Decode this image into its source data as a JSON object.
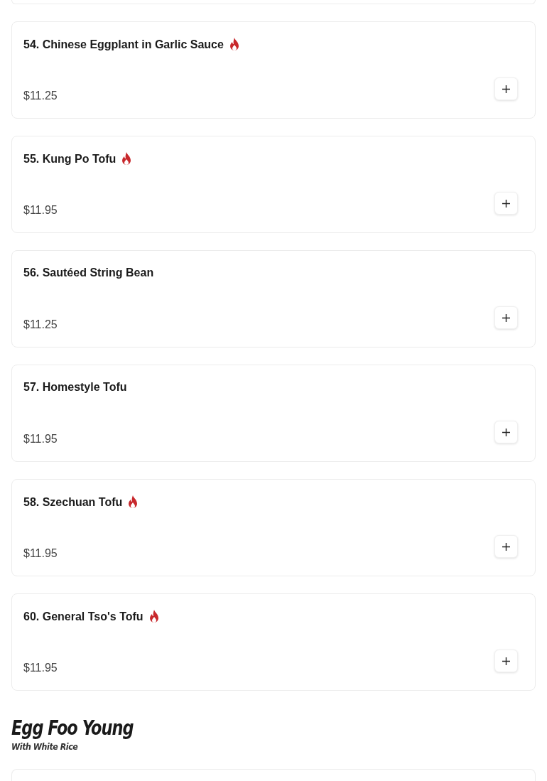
{
  "items": [
    {
      "name": "54. Chinese Eggplant in Garlic Sauce",
      "spicy": true,
      "price": "$11.25"
    },
    {
      "name": "55. Kung Po Tofu",
      "spicy": true,
      "price": "$11.95"
    },
    {
      "name": "56. Sautéed String Bean",
      "spicy": false,
      "price": "$11.25"
    },
    {
      "name": "57. Homestyle Tofu",
      "spicy": false,
      "price": "$11.95"
    },
    {
      "name": "58. Szechuan Tofu",
      "spicy": true,
      "price": "$11.95"
    },
    {
      "name": "60. General Tso's Tofu",
      "spicy": true,
      "price": "$11.95"
    }
  ],
  "next_section": {
    "title": "Egg Foo Young",
    "subtitle": "With White Rice"
  }
}
